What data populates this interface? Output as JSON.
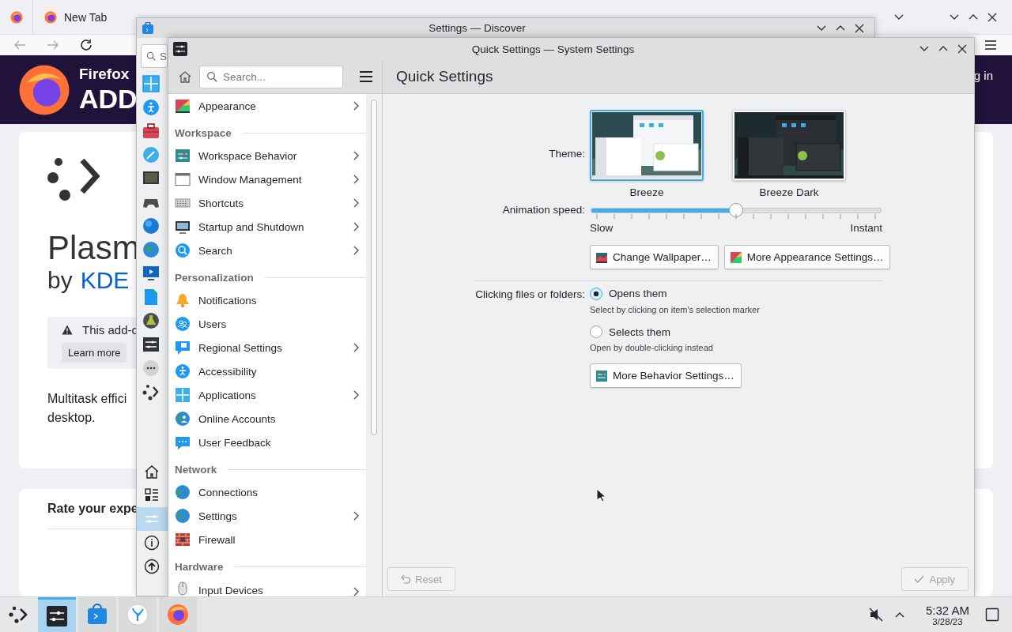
{
  "browser": {
    "tabs": [
      {
        "kind": "pinned",
        "selected": false
      },
      {
        "kind": "normal",
        "label": "New Tab",
        "selected": false
      }
    ],
    "header": {
      "brand": "Firefox",
      "title": "ADD",
      "link": "g in"
    },
    "addon": {
      "name": "Plasm",
      "author_prefix": "by",
      "author": "KDE",
      "notice": "This add-o",
      "notice_button": "Learn more",
      "description": [
        "Multitask effici",
        "desktop."
      ],
      "rating_title": "Rate your expe"
    }
  },
  "discover": {
    "title": "Settings — Discover",
    "search_placeholder": "S",
    "categories": [
      {
        "selected": false
      },
      {
        "selected": false
      },
      {
        "selected": false
      },
      {
        "selected": false
      },
      {
        "selected": false
      },
      {
        "selected": false
      },
      {
        "selected": false
      },
      {
        "selected": false
      },
      {
        "selected": false
      },
      {
        "selected": false
      },
      {
        "selected": false
      },
      {
        "selected": false
      },
      {
        "selected": false
      },
      {
        "selected": false
      }
    ],
    "nav": [
      {
        "selected": false
      },
      {
        "selected": false
      },
      {
        "selected": true
      },
      {
        "selected": false
      },
      {
        "selected": false
      }
    ]
  },
  "settings": {
    "title": "Quick Settings — System Settings",
    "search_placeholder": "Search...",
    "page_title": "Quick Settings",
    "sidebar": [
      {
        "kind": "item",
        "label": "Appearance",
        "chevron": true
      },
      {
        "kind": "header",
        "label": "Workspace"
      },
      {
        "kind": "item",
        "label": "Workspace Behavior",
        "chevron": true
      },
      {
        "kind": "item",
        "label": "Window Management",
        "chevron": true
      },
      {
        "kind": "item",
        "label": "Shortcuts",
        "chevron": true
      },
      {
        "kind": "item",
        "label": "Startup and Shutdown",
        "chevron": true
      },
      {
        "kind": "item",
        "label": "Search",
        "chevron": true
      },
      {
        "kind": "header",
        "label": "Personalization"
      },
      {
        "kind": "item",
        "label": "Notifications",
        "chevron": false
      },
      {
        "kind": "item",
        "label": "Users",
        "chevron": false
      },
      {
        "kind": "item",
        "label": "Regional Settings",
        "chevron": true
      },
      {
        "kind": "item",
        "label": "Accessibility",
        "chevron": false
      },
      {
        "kind": "item",
        "label": "Applications",
        "chevron": true
      },
      {
        "kind": "item",
        "label": "Online Accounts",
        "chevron": false
      },
      {
        "kind": "item",
        "label": "User Feedback",
        "chevron": false
      },
      {
        "kind": "header",
        "label": "Network"
      },
      {
        "kind": "item",
        "label": "Connections",
        "chevron": false
      },
      {
        "kind": "item",
        "label": "Settings",
        "chevron": true
      },
      {
        "kind": "item",
        "label": "Firewall",
        "chevron": false
      },
      {
        "kind": "header",
        "label": "Hardware"
      },
      {
        "kind": "item",
        "label": "Input Devices",
        "chevron": true
      }
    ],
    "theme": {
      "label": "Theme:",
      "options": [
        {
          "name": "Breeze",
          "dark": false,
          "selected": true
        },
        {
          "name": "Breeze Dark",
          "dark": true,
          "selected": false
        }
      ]
    },
    "animation": {
      "label": "Animation speed:",
      "level": 0.5,
      "min_label": "Slow",
      "max_label": "Instant"
    },
    "appearance_buttons": [
      "Change Wallpaper…",
      "More Appearance Settings…"
    ],
    "click_behavior": {
      "label": "Clicking files or folders:",
      "options": [
        {
          "label": "Opens them",
          "hint": "Select by clicking on item's selection marker",
          "selected": true
        },
        {
          "label": "Selects them",
          "hint": "Open by double-clicking instead",
          "selected": false
        }
      ]
    },
    "behavior_button": "More Behavior Settings…",
    "footer": {
      "reset": {
        "label": "Reset",
        "disabled": true
      },
      "apply": {
        "label": "Apply",
        "disabled": true
      }
    }
  },
  "taskbar": {
    "tasks": [
      {
        "selected": true
      },
      {
        "selected": false
      },
      {
        "selected": false
      },
      {
        "selected": false
      }
    ],
    "volume_muted": true,
    "time": "5:32 AM",
    "date": "3/28/23"
  }
}
